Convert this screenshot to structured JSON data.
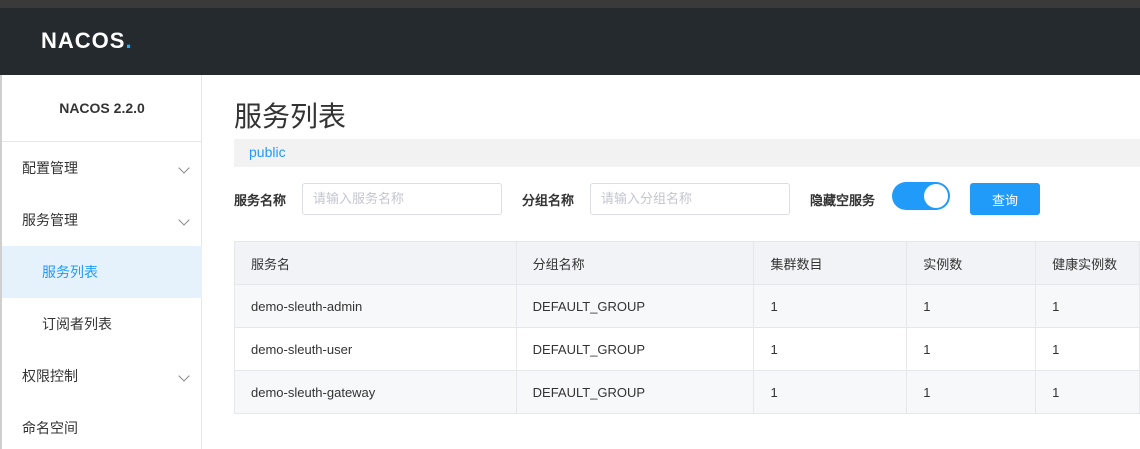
{
  "header": {
    "logo_text": "NACOS",
    "logo_dot": "."
  },
  "sidebar": {
    "version": "NACOS 2.2.0",
    "items": [
      {
        "label": "配置管理",
        "has_chevron": true
      },
      {
        "label": "服务管理",
        "has_chevron": true
      },
      {
        "label": "服务列表",
        "active": true
      },
      {
        "label": "订阅者列表"
      },
      {
        "label": "权限控制",
        "has_chevron": true
      },
      {
        "label": "命名空间"
      }
    ]
  },
  "main": {
    "title": "服务列表",
    "namespace": "public",
    "filters": {
      "service_name_label": "服务名称",
      "service_name_placeholder": "请输入服务名称",
      "service_name_value": "",
      "group_name_label": "分组名称",
      "group_name_placeholder": "请输入分组名称",
      "group_name_value": "",
      "hide_empty_label": "隐藏空服务",
      "hide_empty_on": true,
      "query_label": "查询"
    },
    "table": {
      "columns": [
        "服务名",
        "分组名称",
        "集群数目",
        "实例数",
        "健康实例数"
      ],
      "rows": [
        [
          "demo-sleuth-admin",
          "DEFAULT_GROUP",
          "1",
          "1",
          "1"
        ],
        [
          "demo-sleuth-user",
          "DEFAULT_GROUP",
          "1",
          "1",
          "1"
        ],
        [
          "demo-sleuth-gateway",
          "DEFAULT_GROUP",
          "1",
          "1",
          "1"
        ]
      ]
    }
  },
  "colors": {
    "accent": "#209bfa",
    "header_bg": "#252a2f",
    "logo_dot": "#1ab2ff",
    "active_bg": "#e6f2fb"
  }
}
